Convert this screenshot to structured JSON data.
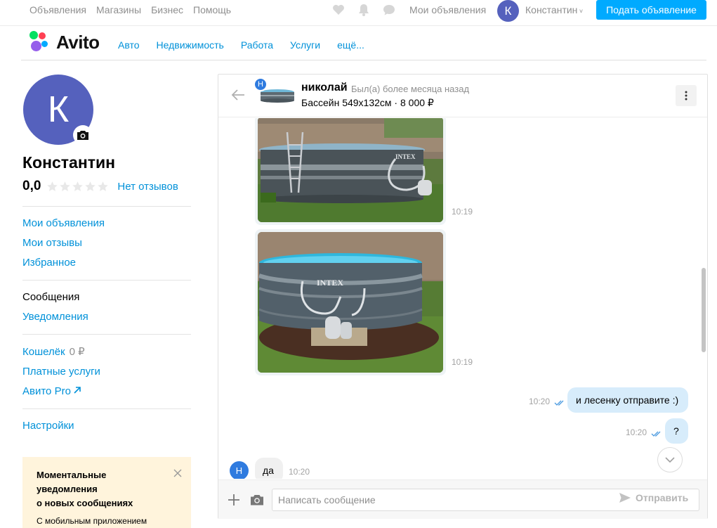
{
  "topbar": {
    "links": [
      "Объявления",
      "Магазины",
      "Бизнес",
      "Помощь"
    ],
    "my_ads": "Мои объявления",
    "avatar_letter": "К",
    "user_name": "Константин",
    "post_button": "Подать объявление",
    "icons": [
      "heart-icon",
      "bell-icon",
      "chat-icon"
    ]
  },
  "header": {
    "logo_text": "Avito",
    "nav": [
      "Авто",
      "Недвижимость",
      "Работа",
      "Услуги",
      "ещё..."
    ]
  },
  "profile": {
    "avatar_letter": "К",
    "name": "Константин",
    "rating": "0,0",
    "reviews_label": "Нет отзывов",
    "stars_filled": 0,
    "stars_total": 5
  },
  "sidebar": {
    "group1": [
      "Мои объявления",
      "Мои отзывы",
      "Избранное"
    ],
    "group2": [
      "Сообщения",
      "Уведомления"
    ],
    "wallet_label": "Кошелёк",
    "wallet_value": "0 ₽",
    "paid_services": "Платные услуги",
    "avito_pro": "Авито Pro",
    "settings": "Настройки"
  },
  "promo": {
    "title_lines": [
      "Моментальные",
      "уведомления",
      "о новых сообщениях"
    ],
    "text": "С мобильным приложением"
  },
  "chat": {
    "header": {
      "badge_letter": "Н",
      "user": "николай",
      "status": "Был(а) более месяца назад",
      "item": "Бассейн 549x132см · 8 000 ₽"
    },
    "messages": [
      {
        "type": "image",
        "time": "10:19"
      },
      {
        "type": "image",
        "time": "10:19"
      },
      {
        "type": "out",
        "text": "и лесенку отправите :)",
        "time": "10:20"
      },
      {
        "type": "out",
        "text": "?",
        "time": "10:20"
      },
      {
        "type": "in",
        "avatar_letter": "Н",
        "text": "да",
        "time": "10:20"
      }
    ],
    "composer": {
      "placeholder": "Написать сообщение",
      "send_label": "Отправить"
    }
  },
  "colors": {
    "accent": "#00aaff",
    "link": "#0091d9",
    "avatar": "#5561bd",
    "chat_avatar": "#2f7bdf",
    "bubble_out": "#d7ecfb",
    "promo_bg": "#fff4dc"
  }
}
